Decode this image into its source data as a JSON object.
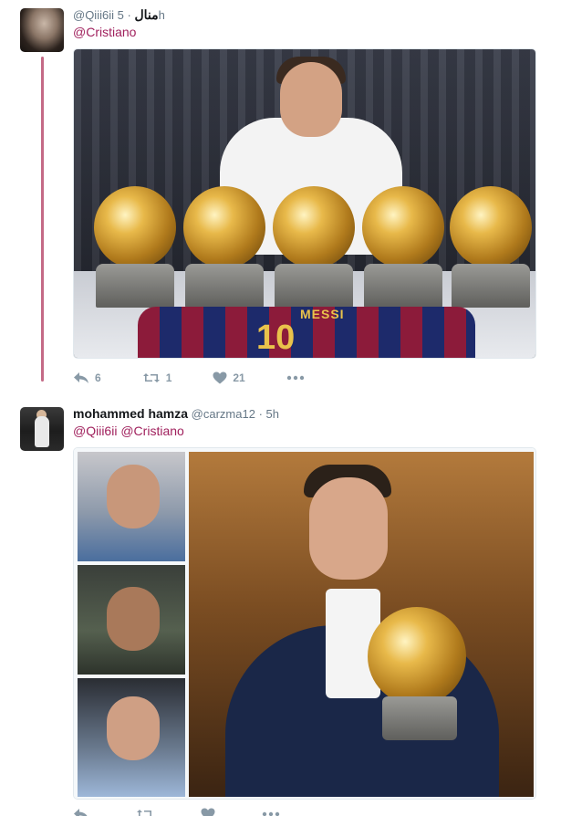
{
  "thread_color": "#c46a86",
  "mention_color": "#a0215d",
  "tweets": [
    {
      "display_name": "",
      "handle": "@Qiii6ii",
      "display_name_rtl": "منال",
      "separator": "·",
      "time": "5h",
      "reply_to": [
        "@Cristiano"
      ],
      "media": {
        "jersey_name": "MESSI",
        "jersey_number": "10"
      },
      "actions": {
        "reply_count": "6",
        "retweet_count": "1",
        "like_count": "21"
      },
      "icons": [
        "reply-icon",
        "retweet-icon",
        "heart-icon",
        "more-icon"
      ]
    },
    {
      "display_name": "mohammed hamza",
      "handle": "@carzma12",
      "separator": "·",
      "time": "5h",
      "reply_to": [
        "@Qiii6ii",
        "@Cristiano"
      ],
      "actions": {
        "reply_count": "",
        "retweet_count": "",
        "like_count": ""
      },
      "icons": [
        "reply-icon",
        "retweet-icon",
        "heart-icon",
        "more-icon"
      ]
    }
  ]
}
